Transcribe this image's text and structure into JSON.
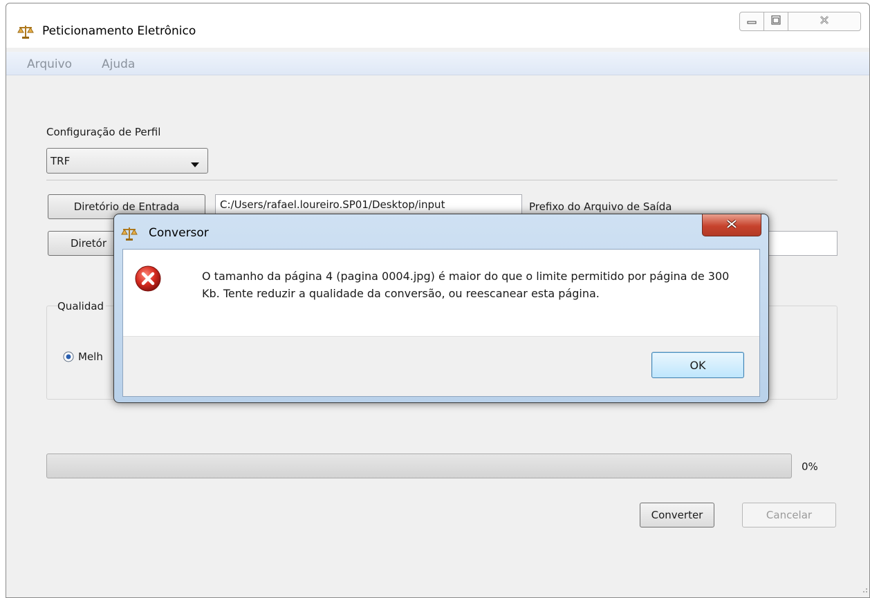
{
  "window": {
    "title": "Peticionamento Eletrônico",
    "controls": {
      "minimize": "minimize-icon",
      "maximize": "maximize-icon",
      "close": "close-icon"
    }
  },
  "menu": {
    "items": [
      "Arquivo",
      "Ajuda"
    ]
  },
  "profile": {
    "label": "Configuração de Perfil",
    "selected": "TRF"
  },
  "input_dir": {
    "button": "Diretório de Entrada",
    "value": "C:/Users/rafael.loureiro.SP01/Desktop/input"
  },
  "output_prefix": {
    "label": "Prefixo do Arquivo de Saída"
  },
  "output_dir": {
    "button_partial": "Diretór"
  },
  "quality": {
    "label_partial": "Qualidad",
    "option_partial": "Melh"
  },
  "progress": {
    "percent_text": "0%",
    "value": 0
  },
  "actions": {
    "convert": "Converter",
    "cancel": "Cancelar"
  },
  "dialog": {
    "title": "Conversor",
    "icon": "error-icon",
    "message": "O tamanho da página 4 (pagina 0004.jpg) é maior do que o limite permitido por página de 300 Kb. Tente reduzir a qualidade da conversão, ou reescanear esta página.",
    "ok": "OK"
  },
  "colors": {
    "accent": "#3c7fb1",
    "error": "#d32f2f",
    "dialog_frame": "#b9d1ea"
  }
}
